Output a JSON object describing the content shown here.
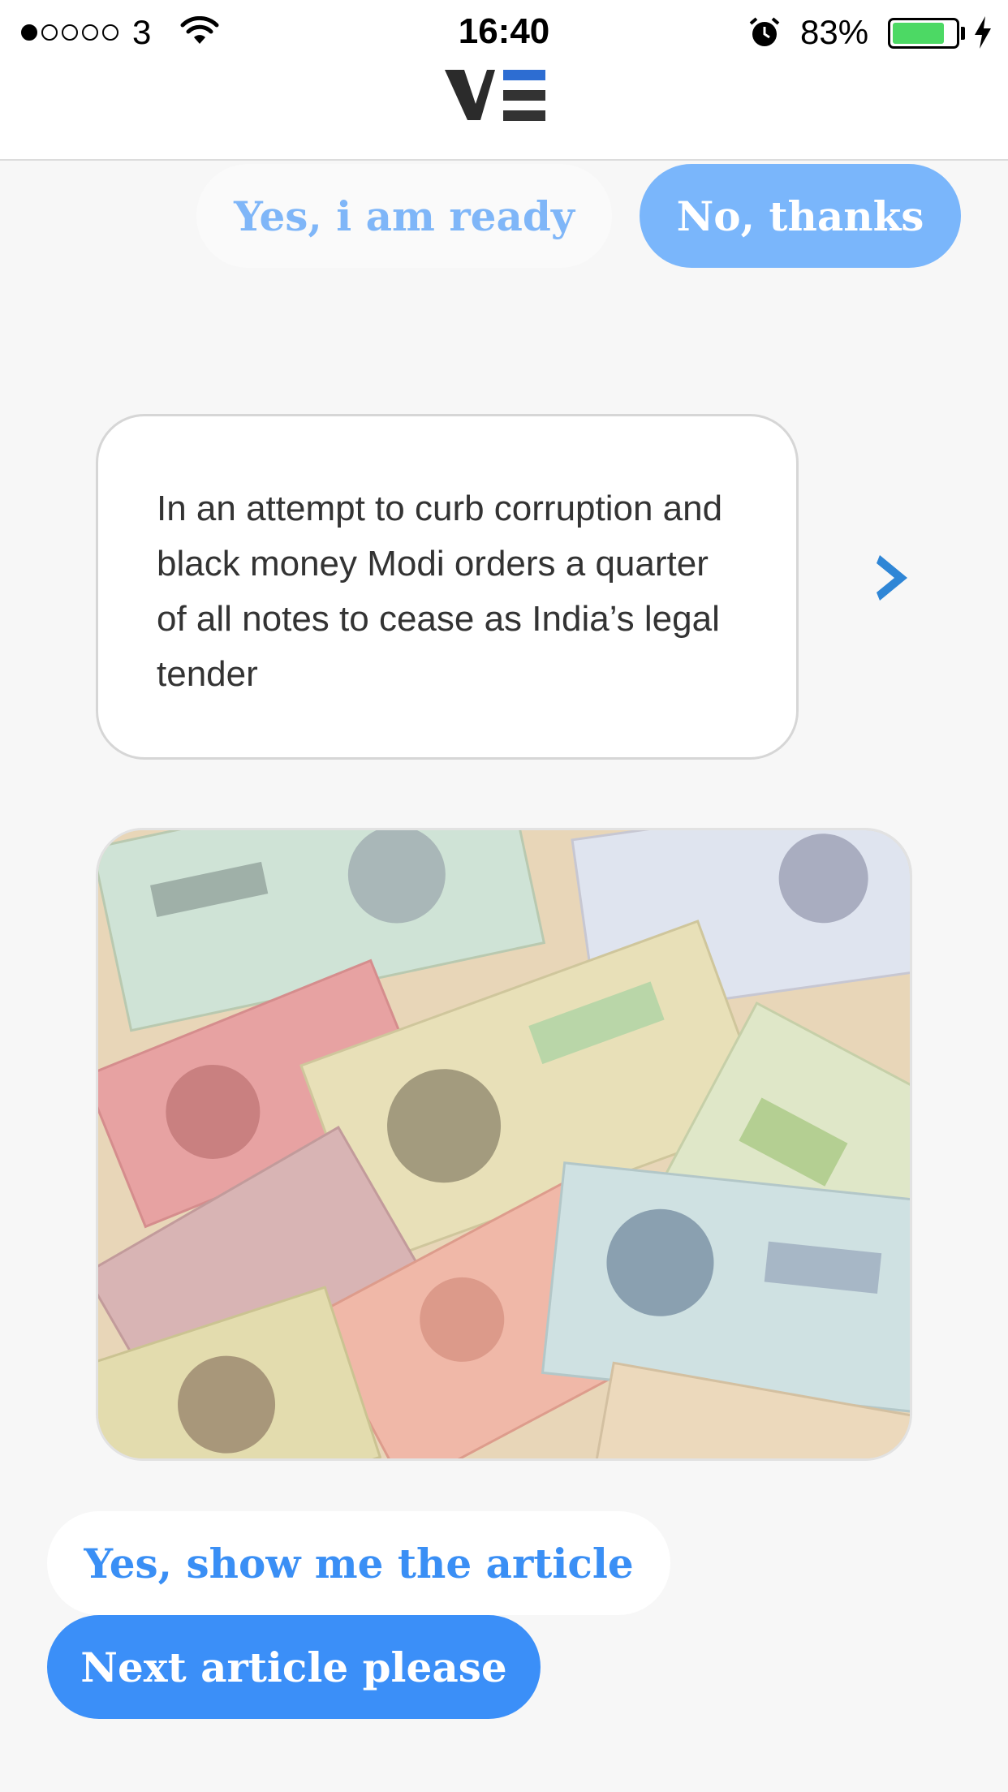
{
  "status_bar": {
    "carrier": "3",
    "time": "16:40",
    "battery": "83%",
    "battery_level": 0.83
  },
  "brand": {
    "logo": "VE"
  },
  "colors": {
    "primary_blue": "#3b8ff8",
    "light_blue": "#7ab6fb",
    "background": "#f7f7f7",
    "battery_green": "#4cd964"
  },
  "top_replies": {
    "yes_label": "Yes, i am ready",
    "no_label": "No, thanks"
  },
  "message": {
    "text": "In an attempt to curb corruption and black money Modi orders a quarter of all notes to cease as India’s legal tender"
  },
  "image": {
    "description": "Indian rupee banknotes"
  },
  "bottom_replies": {
    "show_article_label": "Yes, show me the article",
    "next_article_label": "Next article please"
  },
  "icons": {
    "next": "chevron-right-icon",
    "wifi": "wifi-icon",
    "alarm": "alarm-icon",
    "charging": "charging-bolt-icon"
  }
}
